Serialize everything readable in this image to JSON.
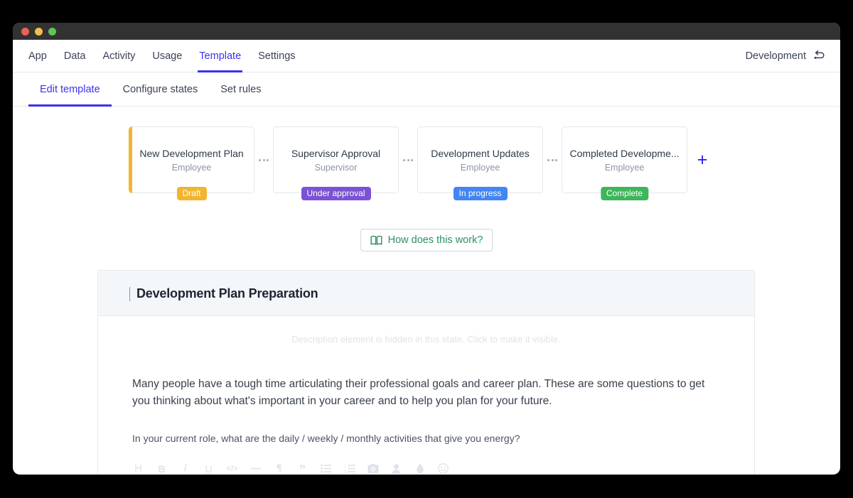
{
  "window": {
    "traffic_lights": [
      "close",
      "minimize",
      "zoom"
    ]
  },
  "topnav": {
    "tabs": [
      {
        "label": "App",
        "active": false
      },
      {
        "label": "Data",
        "active": false
      },
      {
        "label": "Activity",
        "active": false
      },
      {
        "label": "Usage",
        "active": false
      },
      {
        "label": "Template",
        "active": true
      },
      {
        "label": "Settings",
        "active": false
      }
    ],
    "environment_label": "Development",
    "revert_icon": "revert-arrow-icon",
    "active_color": "#3b31f0"
  },
  "subnav": {
    "tabs": [
      {
        "label": "Edit template",
        "active": true
      },
      {
        "label": "Configure states",
        "active": false
      },
      {
        "label": "Set rules",
        "active": false
      }
    ]
  },
  "states": {
    "cards": [
      {
        "title": "New Development Plan",
        "role": "Employee",
        "badge": "Draft",
        "badge_color": "#f2b530",
        "accent_color": "#f2b530",
        "has_accent": true
      },
      {
        "title": "Supervisor Approval",
        "role": "Supervisor",
        "badge": "Under approval",
        "badge_color": "#7b52d3",
        "accent_color": "",
        "has_accent": false
      },
      {
        "title": "Development Updates",
        "role": "Employee",
        "badge": "In progress",
        "badge_color": "#4285f4",
        "accent_color": "",
        "has_accent": false
      },
      {
        "title": "Completed Developme...",
        "role": "Employee",
        "badge": "Complete",
        "badge_color": "#3fb559",
        "accent_color": "",
        "has_accent": false
      }
    ],
    "add_label": "+",
    "separator_icon": "ellipsis-icon"
  },
  "howto": {
    "label": "How does this work?",
    "icon": "book-icon",
    "color": "#2a9160"
  },
  "panel": {
    "title": "Development Plan Preparation",
    "hidden_description_note": "Description element is hidden in this state. Click to make it visible.",
    "paragraph": "Many people have a tough time articulating their professional goals and career plan. These are some questions to get you thinking about what's important in your career and to help you plan for your future.",
    "question": "In your current role, what are the daily / weekly / monthly activities that give you energy?",
    "toolbar": [
      {
        "icon": "heading-icon",
        "glyph": "H"
      },
      {
        "icon": "bold-icon",
        "glyph": "B"
      },
      {
        "icon": "italic-icon",
        "glyph": "I"
      },
      {
        "icon": "underline-icon",
        "glyph": "U"
      },
      {
        "icon": "code-icon",
        "glyph": "</>"
      },
      {
        "icon": "horizontal-rule-icon",
        "glyph": "—"
      },
      {
        "icon": "paragraph-icon",
        "glyph": "¶"
      },
      {
        "icon": "blockquote-icon",
        "glyph": "”"
      },
      {
        "icon": "bulleted-list-icon",
        "glyph": ""
      },
      {
        "icon": "numbered-list-icon",
        "glyph": ""
      },
      {
        "icon": "image-icon",
        "glyph": ""
      },
      {
        "icon": "mention-person-icon",
        "glyph": ""
      },
      {
        "icon": "color-droplet-icon",
        "glyph": ""
      },
      {
        "icon": "emoji-icon",
        "glyph": ""
      }
    ]
  }
}
